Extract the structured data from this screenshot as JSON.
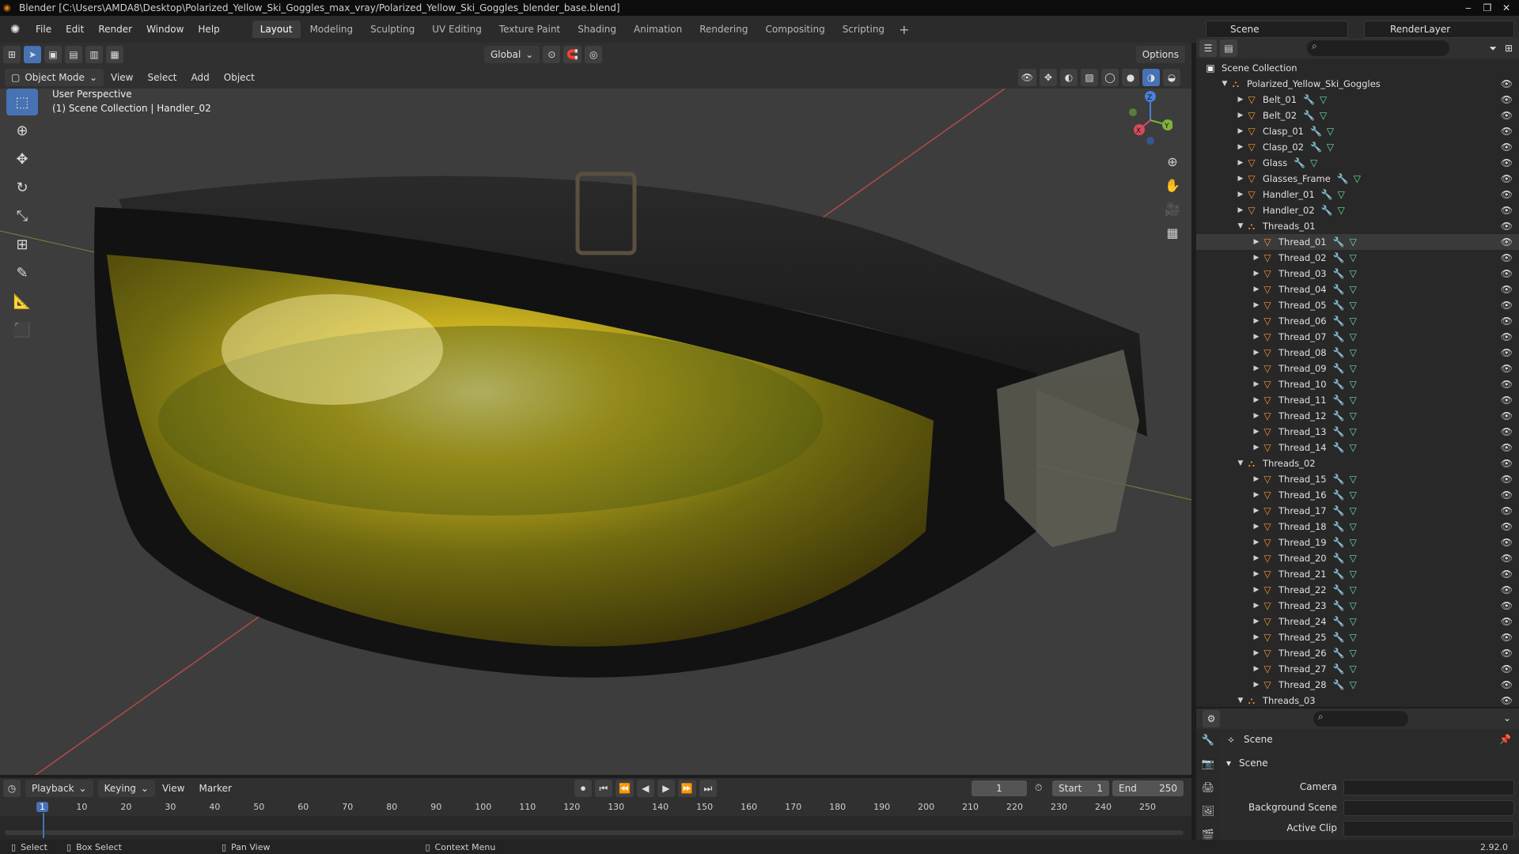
{
  "window": {
    "title": "Blender [C:\\Users\\AMDA8\\Desktop\\Polarized_Yellow_Ski_Goggles_max_vray/Polarized_Yellow_Ski_Goggles_blender_base.blend]",
    "buttons": [
      "‒",
      "❐",
      "✕"
    ]
  },
  "menu": {
    "items": [
      "File",
      "Edit",
      "Render",
      "Window",
      "Help"
    ],
    "workspaces": [
      "Layout",
      "Modeling",
      "Sculpting",
      "UV Editing",
      "Texture Paint",
      "Shading",
      "Animation",
      "Rendering",
      "Compositing",
      "Scripting"
    ],
    "active_workspace": "Layout",
    "add": "+",
    "scene": "Scene",
    "render_layer": "RenderLayer"
  },
  "viewport_header": {
    "transform": "Global",
    "options": "Options",
    "mode": "Object Mode",
    "menus": [
      "View",
      "Select",
      "Add",
      "Object"
    ]
  },
  "viewport": {
    "perspective": "User Perspective",
    "context": "(1) Scene Collection | Handler_02",
    "gizmo": {
      "x": "X",
      "y": "Y",
      "z": "Z"
    }
  },
  "outliner": {
    "root": "Scene Collection",
    "collection": "Polarized_Yellow_Ski_Goggles",
    "objects": [
      "Belt_01",
      "Belt_02",
      "Clasp_01",
      "Clasp_02",
      "Glass",
      "Glasses_Frame",
      "Handler_01",
      "Handler_02"
    ],
    "threads_01": "Threads_01",
    "threads_01_items": [
      "Thread_01",
      "Thread_02",
      "Thread_03",
      "Thread_04",
      "Thread_05",
      "Thread_06",
      "Thread_07",
      "Thread_08",
      "Thread_09",
      "Thread_10",
      "Thread_11",
      "Thread_12",
      "Thread_13",
      "Thread_14"
    ],
    "threads_02": "Threads_02",
    "threads_02_items": [
      "Thread_15",
      "Thread_16",
      "Thread_17",
      "Thread_18",
      "Thread_19",
      "Thread_20",
      "Thread_21",
      "Thread_22",
      "Thread_23",
      "Thread_24",
      "Thread_25",
      "Thread_26",
      "Thread_27",
      "Thread_28"
    ],
    "threads_03": "Threads_03",
    "highlighted": "Thread_01"
  },
  "properties": {
    "context": "Scene",
    "panel": "Scene",
    "camera_label": "Camera",
    "background_label": "Background Scene",
    "clip_label": "Active Clip"
  },
  "timeline": {
    "menus": [
      "Playback",
      "Keying",
      "View",
      "Marker"
    ],
    "current_frame": "1",
    "start_label": "Start",
    "start": "1",
    "end_label": "End",
    "end": "250",
    "ticks": [
      "1",
      "10",
      "20",
      "30",
      "40",
      "50",
      "60",
      "70",
      "80",
      "90",
      "100",
      "110",
      "120",
      "130",
      "140",
      "150",
      "160",
      "170",
      "180",
      "190",
      "200",
      "210",
      "220",
      "230",
      "240",
      "250"
    ],
    "tick_frames": [
      1,
      10,
      20,
      30,
      40,
      50,
      60,
      70,
      80,
      90,
      100,
      110,
      120,
      130,
      140,
      150,
      160,
      170,
      180,
      190,
      200,
      210,
      220,
      230,
      240,
      250
    ]
  },
  "status": {
    "select": "Select",
    "box_select": "Box Select",
    "pan_view": "Pan View",
    "context_menu": "Context Menu",
    "version": "2.92.0"
  },
  "colors": {
    "accent": "#4772b3",
    "object": "#f29a2e",
    "modifier": "#6a9bff",
    "mesh": "#66e0a5",
    "lens": "#c9a914"
  }
}
